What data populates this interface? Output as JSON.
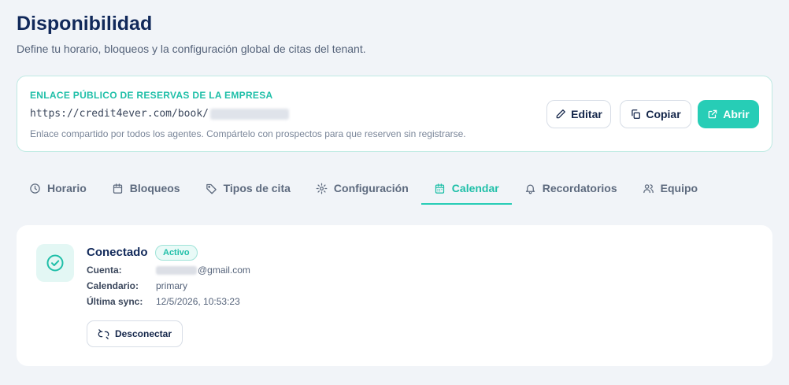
{
  "header": {
    "title": "Disponibilidad",
    "subtitle": "Define tu horario, bloqueos y la configuración global de citas del tenant."
  },
  "public_link": {
    "heading": "ENLACE PÚBLICO DE RESERVAS DE LA EMPRESA",
    "url_prefix": "https://credit4ever.com/book/",
    "note": "Enlace compartido por todos los agentes. Compártelo con prospectos para que reserven sin registrarse.",
    "buttons": {
      "edit": "Editar",
      "copy": "Copiar",
      "open": "Abrir"
    }
  },
  "tabs": [
    {
      "label": "Horario",
      "icon": "clock-icon"
    },
    {
      "label": "Bloqueos",
      "icon": "calendar-icon"
    },
    {
      "label": "Tipos de cita",
      "icon": "tag-icon"
    },
    {
      "label": "Configuración",
      "icon": "gear-icon"
    },
    {
      "label": "Calendar",
      "icon": "calendar-grid-icon",
      "active": true
    },
    {
      "label": "Recordatorios",
      "icon": "bell-icon"
    },
    {
      "label": "Equipo",
      "icon": "users-icon"
    }
  ],
  "calendar": {
    "status": "Conectado",
    "badge": "Activo",
    "account_label": "Cuenta:",
    "account_domain": "@gmail.com",
    "calendar_label": "Calendario:",
    "calendar_value": "primary",
    "sync_label": "Última sync:",
    "sync_value": "12/5/2026, 10:53:23",
    "disconnect_label": "Desconectar"
  },
  "colors": {
    "accent": "#27cdb6",
    "title": "#11295a",
    "background": "#f1f4f8"
  }
}
